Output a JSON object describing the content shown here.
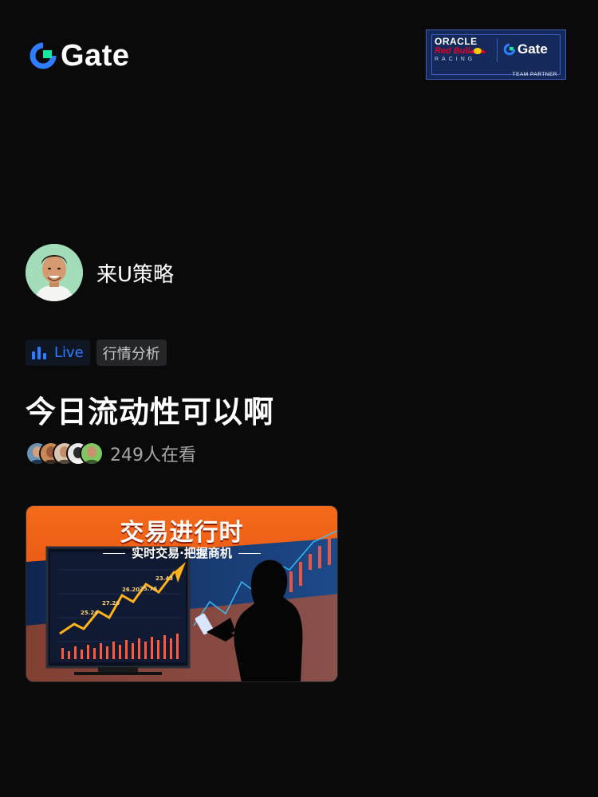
{
  "brand": {
    "name": "Gate"
  },
  "partner": {
    "oracle": "ORACLE",
    "redbull": "Red Bull",
    "racing": "RACING",
    "gate": "Gate",
    "team_partner": "TEAM PARTNER"
  },
  "host": {
    "name": "来U策略"
  },
  "tags": {
    "live": "Live",
    "category": "行情分析"
  },
  "stream": {
    "title": "今日流动性可以啊"
  },
  "viewers": {
    "count_text": "249人在看"
  },
  "banner": {
    "title": "交易进行时",
    "subtitle": "实时交易·把握商机",
    "chart_labels": [
      "25.24",
      "27.26",
      "26.20",
      "25.76",
      "23.43"
    ]
  },
  "colors": {
    "background": "#0a0a0a",
    "brand_blue": "#2f7dff",
    "brand_green": "#17e6a1",
    "banner_orange": "#f05a14"
  }
}
